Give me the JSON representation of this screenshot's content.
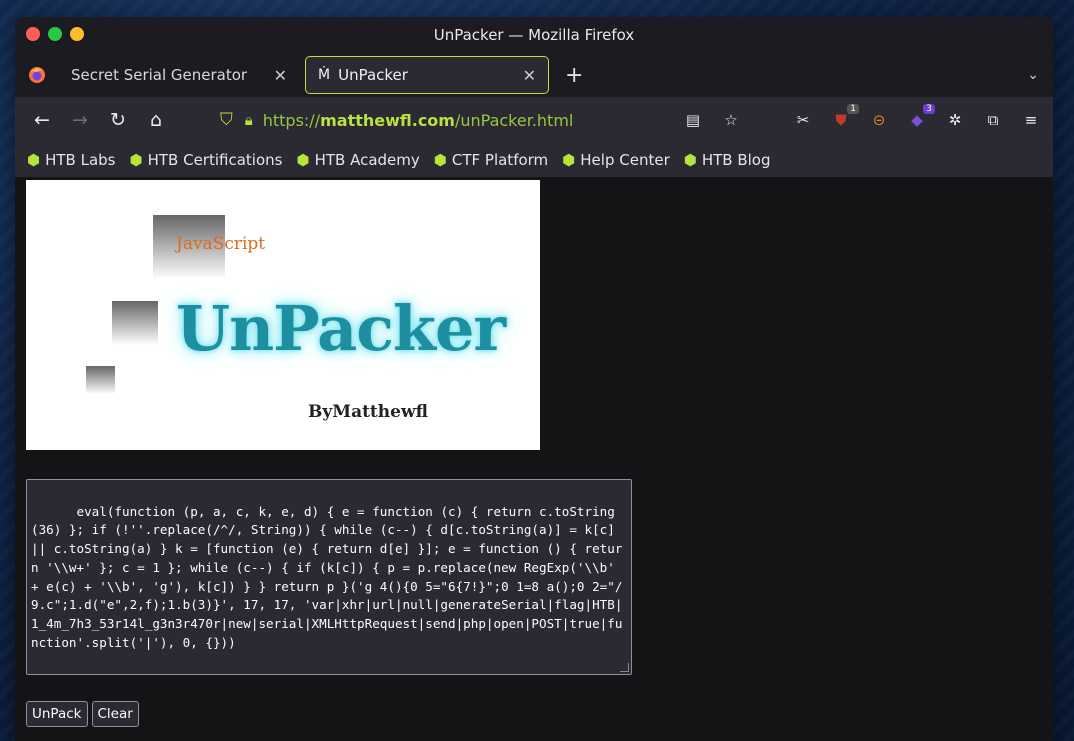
{
  "window": {
    "title": "UnPacker — Mozilla Firefox"
  },
  "tabs": [
    {
      "label": "Secret Serial Generator",
      "active": false
    },
    {
      "label": "UnPacker",
      "active": true
    }
  ],
  "navbar": {
    "url_protocol": "https://",
    "url_domain": "matthewfl.com",
    "url_path": "/unPacker.html",
    "extensions": [
      {
        "icon": "ublock-icon",
        "badge": "1"
      },
      {
        "icon": "privacy-badger-icon",
        "badge": ""
      },
      {
        "icon": "extension-purple-icon",
        "badge": "3"
      }
    ]
  },
  "bookmarks": [
    "HTB Labs",
    "HTB Certifications",
    "HTB Academy",
    "CTF Platform",
    "Help Center",
    "HTB Blog"
  ],
  "banner": {
    "subtitle": "JavaScript",
    "title": "UnPacker",
    "byline": "ByMatthewfl"
  },
  "code": "eval(function (p, a, c, k, e, d) { e = function (c) { return c.toString(36) }; if (!''.replace(/^/, String)) { while (c--) { d[c.toString(a)] = k[c] || c.toString(a) } k = [function (e) { return d[e] }]; e = function () { return '\\\\w+' }; c = 1 }; while (c--) { if (k[c]) { p = p.replace(new RegExp('\\\\b' + e(c) + '\\\\b', 'g'), k[c]) } } return p }('g 4(){0 5=\"6{7!}\";0 1=8 a();0 2=\"/9.c\";1.d(\"e\",2,f);1.b(3)}', 17, 17, 'var|xhr|url|null|generateSerial|flag|HTB|1_4m_7h3_53r14l_g3n3r470r|new|serial|XMLHttpRequest|send|php|open|POST|true|function'.split('|'), 0, {}))",
  "buttons": {
    "unpack": "UnPack",
    "clear": "Clear"
  },
  "colors": {
    "accent": "#b6e33d",
    "chrome": "#2b2a33",
    "page_bg": "#141416"
  }
}
